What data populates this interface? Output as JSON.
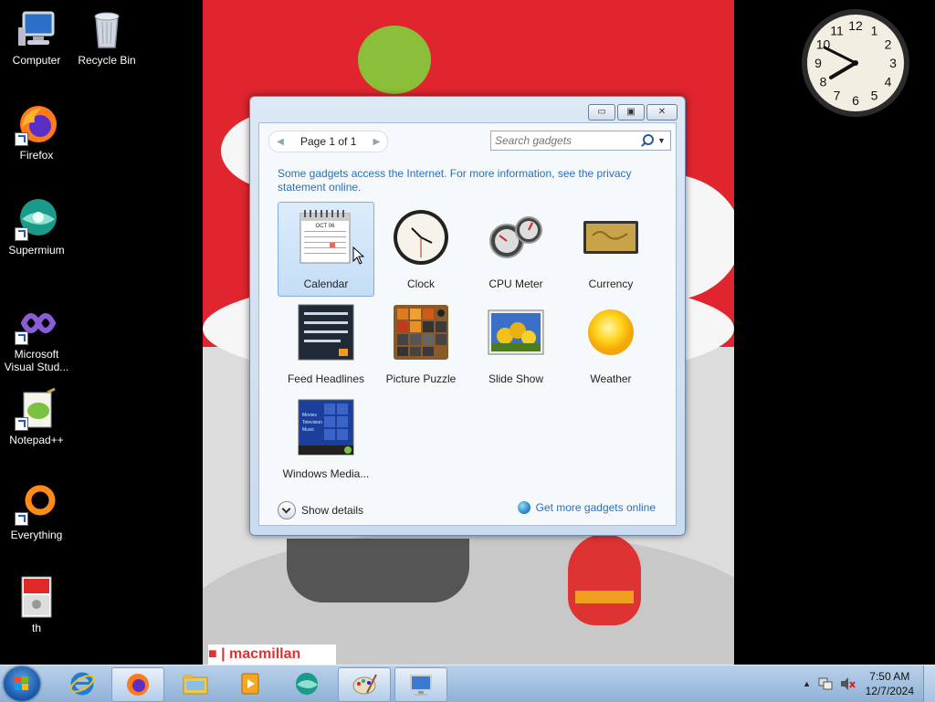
{
  "desktop": {
    "icons": [
      {
        "label": "Computer"
      },
      {
        "label": "Recycle Bin"
      },
      {
        "label": "Firefox"
      },
      {
        "label": "Supermium"
      },
      {
        "label": "Microsoft Visual Stud..."
      },
      {
        "label": "Notepad++"
      },
      {
        "label": "Everything"
      },
      {
        "label": "th"
      }
    ]
  },
  "wallpaper": {
    "logo_text": "macmillan"
  },
  "clock_gadget": {
    "numbers": [
      "12",
      "1",
      "2",
      "3",
      "4",
      "5",
      "6",
      "7",
      "8",
      "9",
      "10",
      "11"
    ],
    "time": "7:50"
  },
  "gallery": {
    "window_buttons": {
      "minimize": "▭",
      "maximize": "▣",
      "close": "✕"
    },
    "pager": {
      "prev": "◀",
      "text": "Page 1 of 1",
      "next": "▶"
    },
    "search": {
      "placeholder": "Search gadgets",
      "icon": "search-icon"
    },
    "notice": "Some gadgets access the Internet.  For more information, see the privacy statement online.",
    "gadgets": [
      {
        "label": "Calendar",
        "selected": true,
        "icon": "calendar-icon",
        "month": "OCT 06"
      },
      {
        "label": "Clock",
        "icon": "clock-icon"
      },
      {
        "label": "CPU Meter",
        "icon": "cpu-meter-icon"
      },
      {
        "label": "Currency",
        "icon": "currency-icon"
      },
      {
        "label": "Feed Headlines",
        "icon": "feed-headlines-icon"
      },
      {
        "label": "Picture Puzzle",
        "icon": "picture-puzzle-icon"
      },
      {
        "label": "Slide Show",
        "icon": "slide-show-icon"
      },
      {
        "label": "Weather",
        "icon": "weather-icon"
      },
      {
        "label": "Windows Media...",
        "icon": "windows-media-icon",
        "menu": [
          "Movies",
          "Television",
          "Music"
        ]
      }
    ],
    "show_details": "Show details",
    "more_online": "Get more gadgets online"
  },
  "taskbar": {
    "apps": [
      "Internet Explorer",
      "Firefox",
      "File Explorer",
      "Media Player",
      "Supermium",
      "Paint",
      "Remote Desktop"
    ],
    "tray_up": "▲",
    "time": "7:50 AM",
    "date": "12/7/2024"
  },
  "colors": {
    "accent_link": "#2a6fb8",
    "selection": "#c4ddf6",
    "taskbar": "#9bbde0"
  }
}
